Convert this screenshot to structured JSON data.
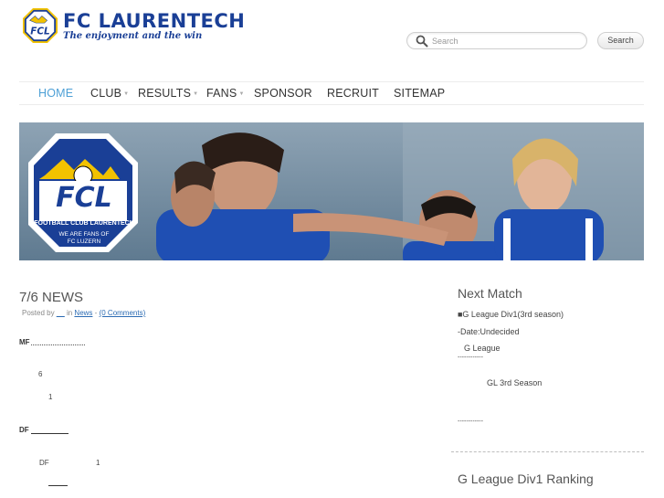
{
  "header": {
    "brand": "FC LAURENTECH",
    "tagline": "The enjoyment and the win",
    "logo_icon": "fcl-club-crest",
    "search_placeholder": "Search",
    "search_button": "Search"
  },
  "nav": {
    "items": [
      {
        "label": "HOME",
        "active": true
      },
      {
        "label": "CLUB",
        "dropdown": true
      },
      {
        "label": "RESULTS",
        "dropdown": true
      },
      {
        "label": "FANS",
        "dropdown": true
      },
      {
        "label": "SPONSOR"
      },
      {
        "label": "RECRUIT"
      },
      {
        "label": "SITEMAP"
      }
    ],
    "active_color": "#4ea0d6"
  },
  "banner": {
    "crest_text": "FCL",
    "crest_caption": "FOOTBALL CLUB LAURENTECH",
    "crest_fans": "WE ARE FANS OF",
    "crest_city": "FC LUZERN"
  },
  "post": {
    "title": "7/6 NEWS",
    "meta_posted_by": "Posted by",
    "meta_author": "__",
    "meta_in": "in",
    "meta_category": "News",
    "meta_sep": "-",
    "meta_comments": "(0 Comments)",
    "sections": {
      "mf_label": "MF",
      "mf_num1": "6",
      "mf_num2": "1",
      "df_label": "DF",
      "df_pos": "DF",
      "df_num": "1"
    }
  },
  "sidebar": {
    "next_match_title": "Next Match",
    "match_line": "■G League Div1(3rd season)",
    "date_line": "-Date:Undecided",
    "league_line": "G League",
    "dashes1": "------------",
    "season_line": "GL 3rd Season",
    "dashes2": "------------",
    "ranking_title": "G League Div1 Ranking"
  },
  "colors": {
    "brand": "#1a3f96",
    "link": "#2b6bb3",
    "accent": "#4ea0d6"
  }
}
